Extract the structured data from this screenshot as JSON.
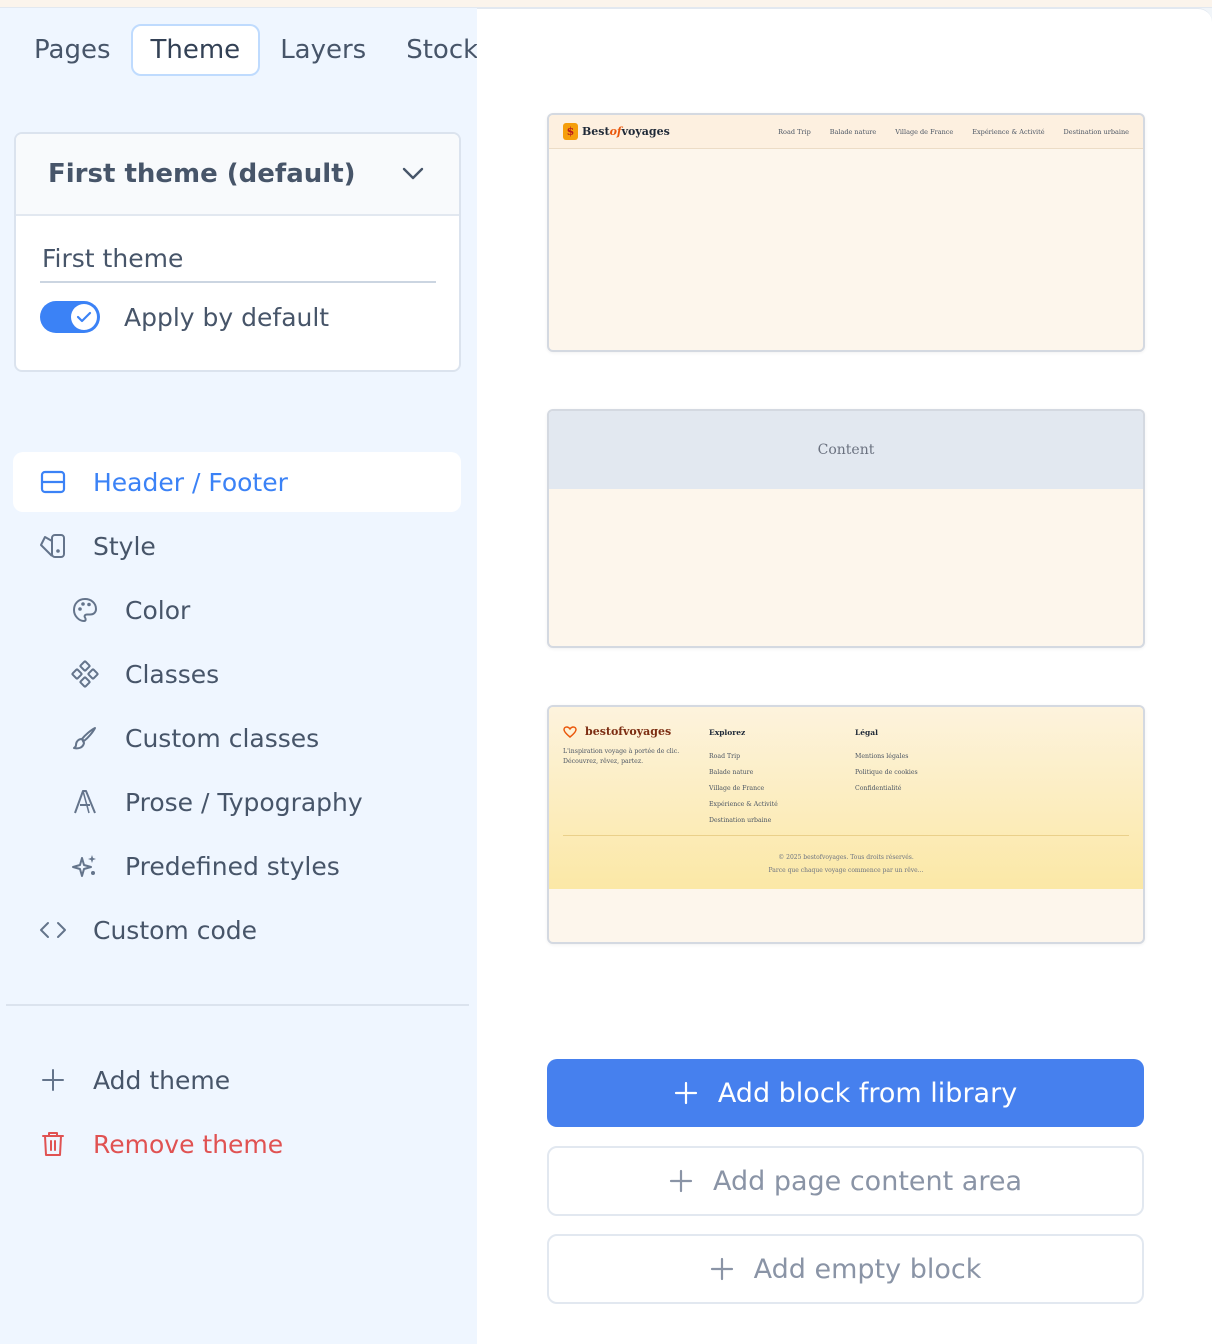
{
  "tabs": [
    {
      "label": "Pages"
    },
    {
      "label": "Theme"
    },
    {
      "label": "Layers"
    },
    {
      "label": "Stock"
    }
  ],
  "theme_card": {
    "selected": "First theme (default)",
    "name_value": "First theme",
    "apply_default_label": "Apply by default",
    "apply_default": true
  },
  "menu": {
    "header_footer": "Header / Footer",
    "style": "Style",
    "color": "Color",
    "classes": "Classes",
    "custom_classes": "Custom classes",
    "prose": "Prose / Typography",
    "predefined": "Predefined styles",
    "custom_code": "Custom code"
  },
  "actions": {
    "add_theme": "Add theme",
    "remove_theme": "Remove theme"
  },
  "header_preview": {
    "logo_best": "Best",
    "logo_of": "of",
    "logo_voyages": "voyages",
    "nav": [
      "Road Trip",
      "Balade nature",
      "Village de France",
      "Expérience & Activité",
      "Destination urbaine"
    ]
  },
  "content_preview": {
    "label": "Content"
  },
  "footer_preview": {
    "brand": "bestofvoyages",
    "tagline": "L'inspiration voyage à portée de clic. Découvrez, rêvez, partez.",
    "col1_title": "Explorez",
    "col1_links": [
      "Road Trip",
      "Balade nature",
      "Village de France",
      "Expérience & Activité",
      "Destination urbaine"
    ],
    "col2_title": "Légal",
    "col2_links": [
      "Mentions légales",
      "Politique de cookies",
      "Confidentialité"
    ],
    "copyright": "© 2025 bestofvoyages. Tous droits réservés.",
    "slogan": "Parce que chaque voyage commence par un rêve..."
  },
  "buttons": {
    "add_block_library": "Add block from library",
    "add_content_area": "Add page content area",
    "add_empty_block": "Add empty block"
  },
  "colors": {
    "accent": "#4680ee",
    "danger": "#e05252",
    "sidebar_bg": "#eff6ff"
  }
}
